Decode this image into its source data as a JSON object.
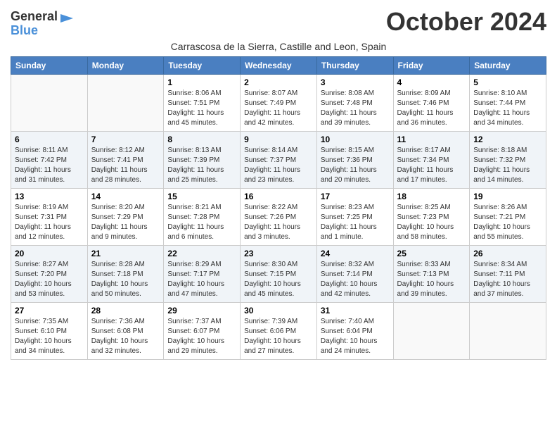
{
  "header": {
    "logo_general": "General",
    "logo_blue": "Blue",
    "month_title": "October 2024",
    "subtitle": "Carrascosa de la Sierra, Castille and Leon, Spain"
  },
  "days_of_week": [
    "Sunday",
    "Monday",
    "Tuesday",
    "Wednesday",
    "Thursday",
    "Friday",
    "Saturday"
  ],
  "weeks": [
    [
      {
        "day": "",
        "info": ""
      },
      {
        "day": "",
        "info": ""
      },
      {
        "day": "1",
        "info": "Sunrise: 8:06 AM\nSunset: 7:51 PM\nDaylight: 11 hours and 45 minutes."
      },
      {
        "day": "2",
        "info": "Sunrise: 8:07 AM\nSunset: 7:49 PM\nDaylight: 11 hours and 42 minutes."
      },
      {
        "day": "3",
        "info": "Sunrise: 8:08 AM\nSunset: 7:48 PM\nDaylight: 11 hours and 39 minutes."
      },
      {
        "day": "4",
        "info": "Sunrise: 8:09 AM\nSunset: 7:46 PM\nDaylight: 11 hours and 36 minutes."
      },
      {
        "day": "5",
        "info": "Sunrise: 8:10 AM\nSunset: 7:44 PM\nDaylight: 11 hours and 34 minutes."
      }
    ],
    [
      {
        "day": "6",
        "info": "Sunrise: 8:11 AM\nSunset: 7:42 PM\nDaylight: 11 hours and 31 minutes."
      },
      {
        "day": "7",
        "info": "Sunrise: 8:12 AM\nSunset: 7:41 PM\nDaylight: 11 hours and 28 minutes."
      },
      {
        "day": "8",
        "info": "Sunrise: 8:13 AM\nSunset: 7:39 PM\nDaylight: 11 hours and 25 minutes."
      },
      {
        "day": "9",
        "info": "Sunrise: 8:14 AM\nSunset: 7:37 PM\nDaylight: 11 hours and 23 minutes."
      },
      {
        "day": "10",
        "info": "Sunrise: 8:15 AM\nSunset: 7:36 PM\nDaylight: 11 hours and 20 minutes."
      },
      {
        "day": "11",
        "info": "Sunrise: 8:17 AM\nSunset: 7:34 PM\nDaylight: 11 hours and 17 minutes."
      },
      {
        "day": "12",
        "info": "Sunrise: 8:18 AM\nSunset: 7:32 PM\nDaylight: 11 hours and 14 minutes."
      }
    ],
    [
      {
        "day": "13",
        "info": "Sunrise: 8:19 AM\nSunset: 7:31 PM\nDaylight: 11 hours and 12 minutes."
      },
      {
        "day": "14",
        "info": "Sunrise: 8:20 AM\nSunset: 7:29 PM\nDaylight: 11 hours and 9 minutes."
      },
      {
        "day": "15",
        "info": "Sunrise: 8:21 AM\nSunset: 7:28 PM\nDaylight: 11 hours and 6 minutes."
      },
      {
        "day": "16",
        "info": "Sunrise: 8:22 AM\nSunset: 7:26 PM\nDaylight: 11 hours and 3 minutes."
      },
      {
        "day": "17",
        "info": "Sunrise: 8:23 AM\nSunset: 7:25 PM\nDaylight: 11 hours and 1 minute."
      },
      {
        "day": "18",
        "info": "Sunrise: 8:25 AM\nSunset: 7:23 PM\nDaylight: 10 hours and 58 minutes."
      },
      {
        "day": "19",
        "info": "Sunrise: 8:26 AM\nSunset: 7:21 PM\nDaylight: 10 hours and 55 minutes."
      }
    ],
    [
      {
        "day": "20",
        "info": "Sunrise: 8:27 AM\nSunset: 7:20 PM\nDaylight: 10 hours and 53 minutes."
      },
      {
        "day": "21",
        "info": "Sunrise: 8:28 AM\nSunset: 7:18 PM\nDaylight: 10 hours and 50 minutes."
      },
      {
        "day": "22",
        "info": "Sunrise: 8:29 AM\nSunset: 7:17 PM\nDaylight: 10 hours and 47 minutes."
      },
      {
        "day": "23",
        "info": "Sunrise: 8:30 AM\nSunset: 7:15 PM\nDaylight: 10 hours and 45 minutes."
      },
      {
        "day": "24",
        "info": "Sunrise: 8:32 AM\nSunset: 7:14 PM\nDaylight: 10 hours and 42 minutes."
      },
      {
        "day": "25",
        "info": "Sunrise: 8:33 AM\nSunset: 7:13 PM\nDaylight: 10 hours and 39 minutes."
      },
      {
        "day": "26",
        "info": "Sunrise: 8:34 AM\nSunset: 7:11 PM\nDaylight: 10 hours and 37 minutes."
      }
    ],
    [
      {
        "day": "27",
        "info": "Sunrise: 7:35 AM\nSunset: 6:10 PM\nDaylight: 10 hours and 34 minutes."
      },
      {
        "day": "28",
        "info": "Sunrise: 7:36 AM\nSunset: 6:08 PM\nDaylight: 10 hours and 32 minutes."
      },
      {
        "day": "29",
        "info": "Sunrise: 7:37 AM\nSunset: 6:07 PM\nDaylight: 10 hours and 29 minutes."
      },
      {
        "day": "30",
        "info": "Sunrise: 7:39 AM\nSunset: 6:06 PM\nDaylight: 10 hours and 27 minutes."
      },
      {
        "day": "31",
        "info": "Sunrise: 7:40 AM\nSunset: 6:04 PM\nDaylight: 10 hours and 24 minutes."
      },
      {
        "day": "",
        "info": ""
      },
      {
        "day": "",
        "info": ""
      }
    ]
  ]
}
